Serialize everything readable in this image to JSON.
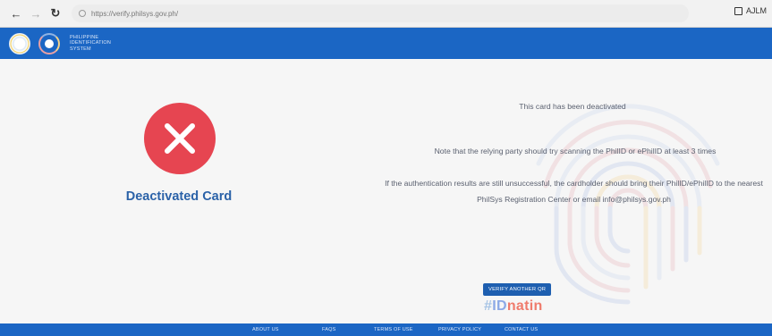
{
  "browser": {
    "url": "https://verify.philsys.gov.ph/",
    "profile": "AJLM"
  },
  "header": {
    "system_name_lines": [
      "PHILIPPINE",
      "IDENTIFICATION",
      "SYSTEM"
    ]
  },
  "main": {
    "status_title": "Deactivated Card",
    "message_1": "This card has been deactivated",
    "message_2": "Note that the relying party should try scanning the PhilID or ePhilID at least 3 times",
    "message_3": "If the authentication results are still unsuccessful, the cardholder should bring their PhilID/ePhilID to the nearest PhilSys Registration Center or email info@philsys.gov.ph",
    "button_label": "VERIFY ANOTHER QR",
    "hashtag": {
      "hash": "#",
      "id": "ID",
      "natin": "natin"
    }
  },
  "footer": {
    "links": [
      "ABOUT US",
      "FAQS",
      "TERMS OF USE",
      "PRIVACY POLICY",
      "CONTACT US"
    ]
  },
  "colors": {
    "header_blue": "#1b66c4",
    "status_red": "#e64551",
    "title_blue": "#2b62a8"
  }
}
